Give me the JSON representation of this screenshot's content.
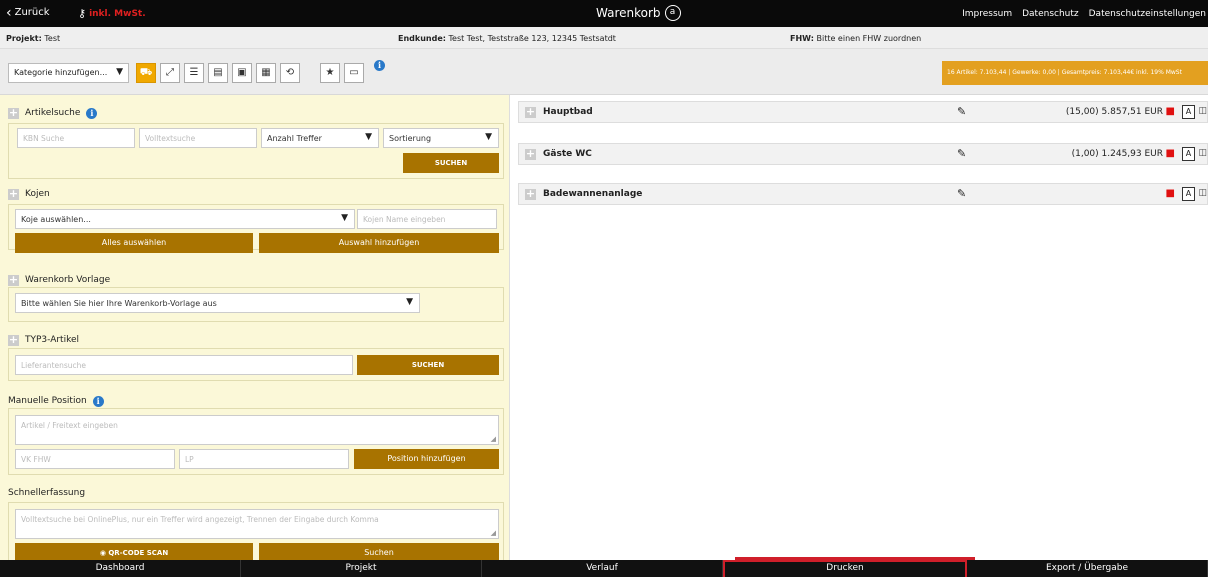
{
  "topbar": {
    "back_label": "Zurück",
    "vat_label": "inkl. MwSt.",
    "title": "Warenkorb",
    "links": [
      "Impressum",
      "Datenschutz",
      "Datenschutzeinstellungen"
    ]
  },
  "infobar": {
    "project_label": "Projekt:",
    "project_value": "Test",
    "customer_label": "Endkunde:",
    "customer_value": "Test Test, Teststraße 123, 12345 Testsatdt",
    "fhw_label": "FHW:",
    "fhw_value": "Bitte einen FHW zuordnen"
  },
  "toolbar": {
    "category_placeholder": "Kategorie hinzufügen...",
    "summary": "16 Artikel: 7.103,44 | Gewerke: 0,00 | Gesamtpreis: 7.103,44€ inkl. 19% MwSt"
  },
  "artikelsuche": {
    "title": "Artikelsuche",
    "kbn_placeholder": "KBN Suche",
    "volltext_placeholder": "Volltextsuche",
    "treffer_label": "Anzahl Treffer",
    "sortierung_label": "Sortierung",
    "search_button": "SUCHEN"
  },
  "kojen": {
    "title": "Kojen",
    "select_label": "Koje auswählen...",
    "name_placeholder": "Kojen Name eingeben",
    "select_all_button": "Alles auswählen",
    "add_selection_button": "Auswahl hinzufügen"
  },
  "vorlage": {
    "title": "Warenkorb Vorlage",
    "select_label": "Bitte wählen Sie hier Ihre Warenkorb-Vorlage aus"
  },
  "typ3": {
    "title": "TYP3-Artikel",
    "supplier_placeholder": "Lieferantensuche",
    "search_button": "SUCHEN"
  },
  "manuelle": {
    "title": "Manuelle Position",
    "article_placeholder": "Artikel / Freitext eingeben",
    "vk_placeholder": "VK FHW",
    "lp_placeholder": "LP",
    "add_button": "Position hinzufügen"
  },
  "schnell": {
    "title": "Schnellerfassung",
    "text_placeholder": "Volltextsuche bei OnlinePlus, nur ein Treffer wird angezeigt, Trennen der Eingabe durch Komma",
    "qr_button": "QR-CODE SCAN",
    "search_button": "Suchen"
  },
  "rooms": [
    {
      "name": "Hauptbad",
      "price": "(15,00) 5.857,51 EUR"
    },
    {
      "name": "Gäste WC",
      "price": "(1,00) 1.245,93 EUR"
    },
    {
      "name": "Badewannenanlage",
      "price": ""
    }
  ],
  "bottomnav": [
    "Dashboard",
    "Projekt",
    "Verlauf",
    "Drucken",
    "Export / Übergabe"
  ],
  "colors": {
    "accent_gold": "#a87300",
    "summary_orange": "#e3a020",
    "highlight_red": "#d01f2a",
    "panel_yellow": "#fbf8d8"
  }
}
